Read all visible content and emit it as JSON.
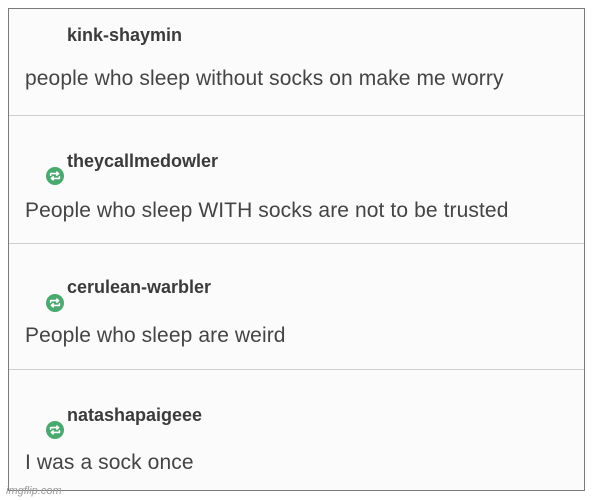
{
  "posts": [
    {
      "username": "kink-shaymin",
      "text": "people who sleep without socks on make me worry",
      "reblog_icon": false
    },
    {
      "username": "theycallmedowler",
      "text": "People who sleep WITH socks are not to be trusted",
      "reblog_icon": true
    },
    {
      "username": "cerulean-warbler",
      "text": "People who sleep are weird",
      "reblog_icon": true
    },
    {
      "username": "natashapaigeee",
      "text": "I was a sock once",
      "reblog_icon": true
    }
  ],
  "watermark": "imgflip.com",
  "icons": {
    "reblog": "reblog-icon"
  },
  "colors": {
    "reblog_green": "#49a96f",
    "text": "#444444",
    "username": "#3b3b3b",
    "border": "#7a7a7a"
  }
}
